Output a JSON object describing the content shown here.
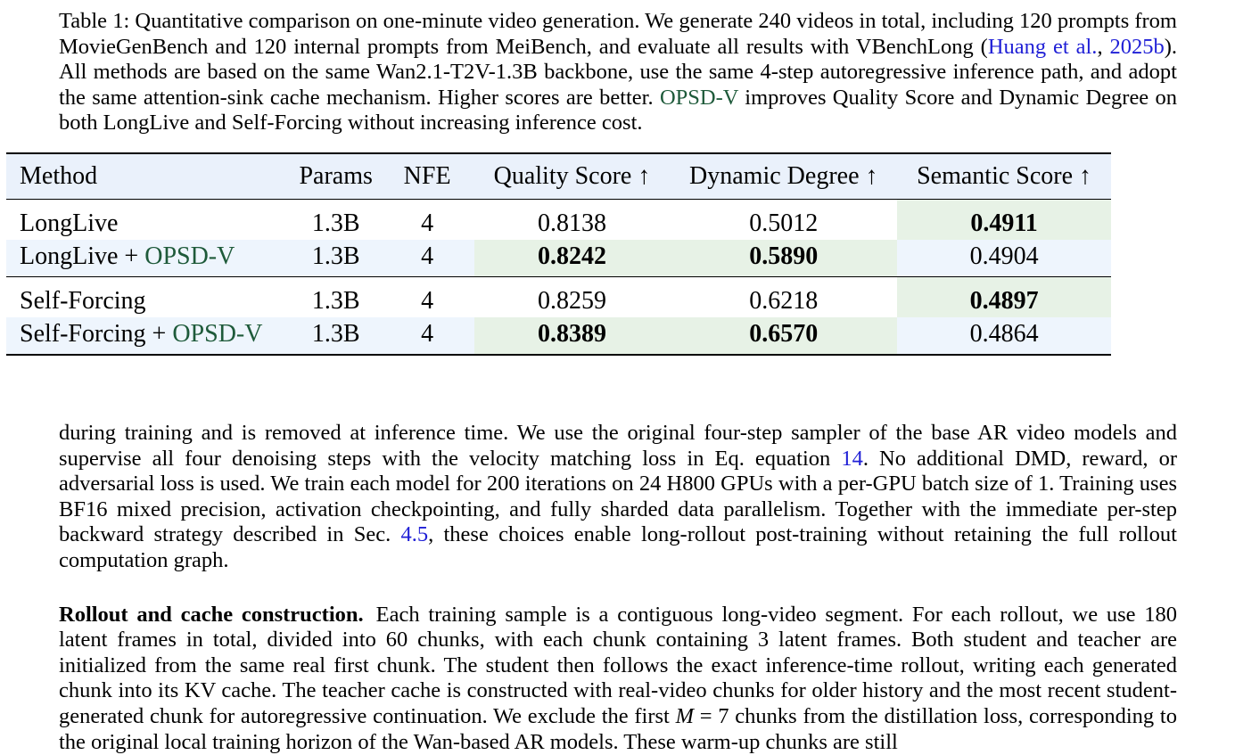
{
  "caption": {
    "label": "Table 1:",
    "text_a": " Quantitative comparison on one-minute video generation. We generate 240 videos in total, including 120 prompts from MovieGenBench and 120 internal prompts from MeiBench, and evaluate all results with VBenchLong (",
    "cite_a": "Huang et al.",
    "text_b": ", ",
    "cite_b": "2025b",
    "text_c": "). All methods are based on the same Wan2.1-T2V-1.3B backbone, use the same 4-step autoregressive inference path, and adopt the same attention-sink cache mechanism. Higher scores are better. ",
    "method_name": "OPSD-V",
    "text_d": " improves Quality Score and Dynamic Degree on both LongLive and Self-Forcing without increasing inference cost."
  },
  "table": {
    "headers": [
      "Method",
      "Params",
      "NFE",
      "Quality Score ↑",
      "Dynamic Degree ↑",
      "Semantic Score ↑"
    ],
    "plus": " + ",
    "groups": [
      {
        "rows": [
          {
            "base": "LongLive",
            "suffix": "",
            "params": "1.3B",
            "nfe": "4",
            "quality": "0.8138",
            "dynamic": "0.5012",
            "semantic": "0.4911",
            "best": [
              "semantic"
            ]
          },
          {
            "base": "LongLive",
            "suffix": "OPSD-V",
            "params": "1.3B",
            "nfe": "4",
            "quality": "0.8242",
            "dynamic": "0.5890",
            "semantic": "0.4904",
            "best": [
              "quality",
              "dynamic"
            ]
          }
        ]
      },
      {
        "rows": [
          {
            "base": "Self-Forcing",
            "suffix": "",
            "params": "1.3B",
            "nfe": "4",
            "quality": "0.8259",
            "dynamic": "0.6218",
            "semantic": "0.4897",
            "best": [
              "semantic"
            ]
          },
          {
            "base": "Self-Forcing",
            "suffix": "OPSD-V",
            "params": "1.3B",
            "nfe": "4",
            "quality": "0.8389",
            "dynamic": "0.6570",
            "semantic": "0.4864",
            "best": [
              "quality",
              "dynamic"
            ]
          }
        ]
      }
    ]
  },
  "body": {
    "p1_a": "during training and is removed at inference time. We use the original four-step sampler of the base AR video models and supervise all four denoising steps with the velocity matching loss in Eq. equation ",
    "p1_ref_eq": "14",
    "p1_b": ". No additional DMD, reward, or adversarial loss is used. We train each model for 200 iterations on 24 H800 GPUs with a per-GPU batch size of 1. Training uses BF16 mixed precision, activation checkpointing, and fully sharded data parallelism. Together with the immediate per-step backward strategy described in Sec. ",
    "p1_ref_sec": "4.5",
    "p1_c": ", these choices enable long-rollout post-training without retaining the full rollout computation graph.",
    "p2_title": "Rollout and cache construction.",
    "p2_a": "Each training sample is a contiguous long-video segment. For each rollout, we use 180 latent frames in total, divided into 60 chunks, with each chunk containing 3 latent frames. Both student and teacher are initialized from the same real first chunk. The student then follows the exact inference-time rollout, writing each generated chunk into its KV cache. The teacher cache is constructed with real-video chunks for older history and the most recent student-generated chunk for autoregressive continuation. We exclude the first ",
    "p2_math": "M",
    "p2_eq": " = 7",
    "p2_b": " chunks from the distillation loss, corresponding to the original local training horizon of the Wan-based AR models. These warm-up chunks are still"
  }
}
